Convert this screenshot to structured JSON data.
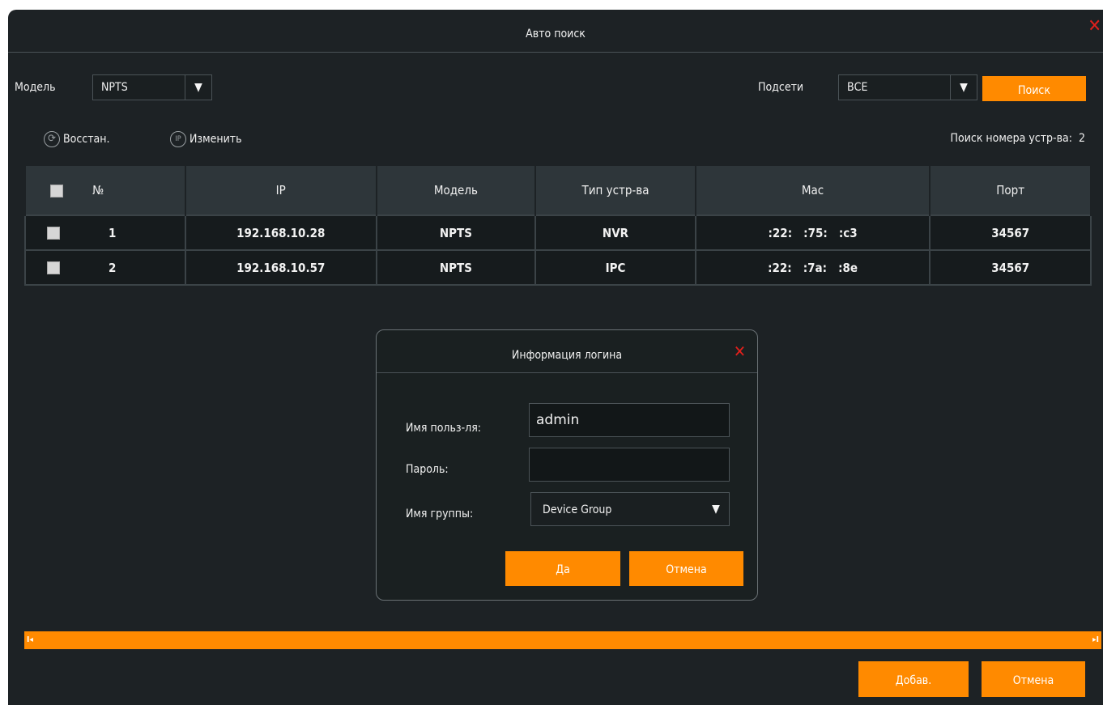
{
  "window": {
    "title": "Авто поиск",
    "close_icon": "✕"
  },
  "filters": {
    "model_label": "Модель",
    "model_value": "NPTS",
    "subnet_label": "Подсети",
    "subnet_value": "ВСЕ",
    "search_button": "Поиск",
    "arrow": "▼"
  },
  "toolbar": {
    "restore_label": "Восстан.",
    "restore_icon": "⟳",
    "change_label": "Изменить",
    "change_icon": "IP",
    "device_count_label": "Поиск номера устр-ва:",
    "device_count": "2"
  },
  "table": {
    "headers": [
      "№",
      "IP",
      "Модель",
      "Тип устр-ва",
      "Mac",
      "Порт"
    ],
    "rows": [
      {
        "no": "1",
        "ip": "192.168.10.28",
        "model": "NPTS",
        "type": "NVR",
        "mac": ":22:   :75:   :c3",
        "port": "34567"
      },
      {
        "no": "2",
        "ip": "192.168.10.57",
        "model": "NPTS",
        "type": "IPC",
        "mac": ":22:   :7a:   :8e",
        "port": "34567"
      }
    ]
  },
  "login": {
    "title": "Информация логина",
    "close_icon": "✕",
    "username_label": "Имя польз-ля:",
    "username_value": "admin",
    "password_label": "Пароль:",
    "password_value": "",
    "group_label": "Имя группы:",
    "group_value": "Device Group",
    "ok_button": "Да",
    "cancel_button": "Отмена"
  },
  "footer": {
    "add_button": "Добав.",
    "cancel_button": "Отмена",
    "scroll_left": "I◂",
    "scroll_right": "▸I"
  }
}
